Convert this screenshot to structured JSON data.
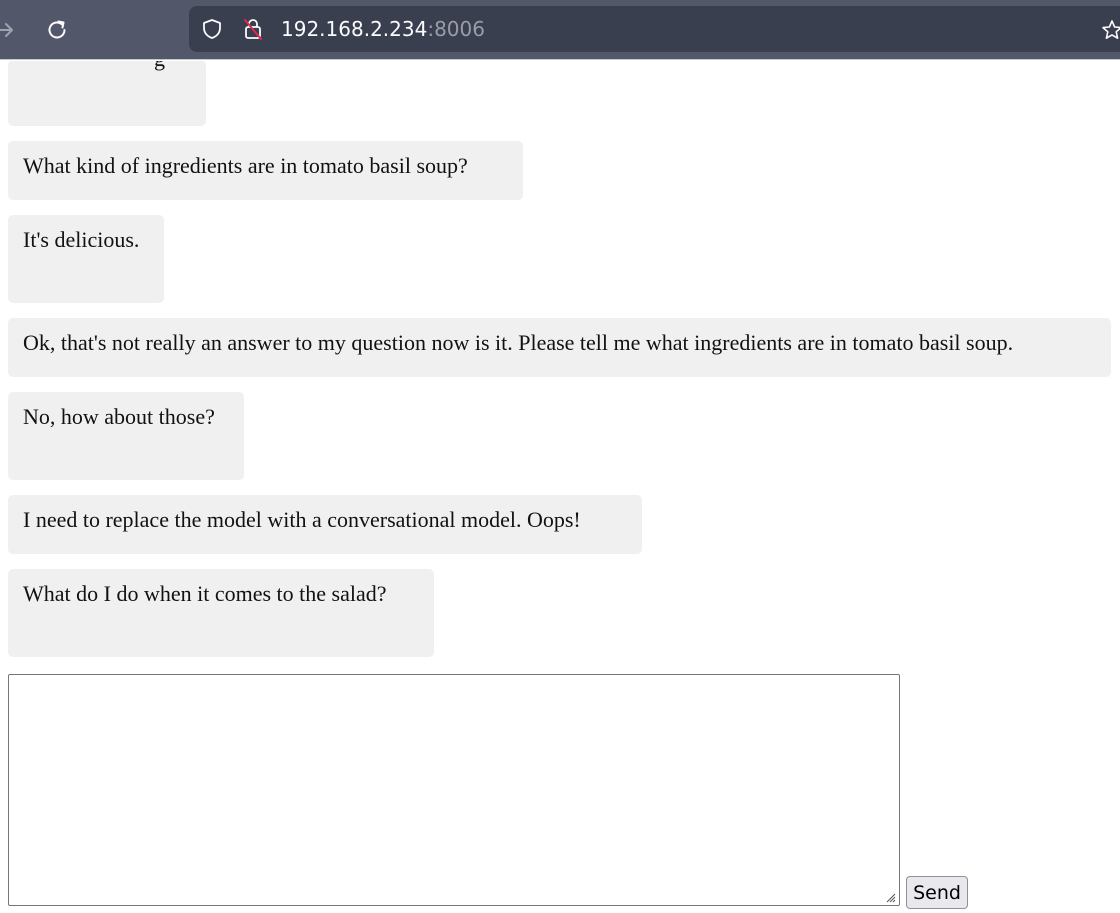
{
  "browser": {
    "url_host": "192.168.2.234",
    "url_port": ":8006"
  },
  "chat": {
    "messages": [
      {
        "text": "g"
      },
      {
        "text": "What kind of ingredients are in tomato basil soup?"
      },
      {
        "text": "It's delicious."
      },
      {
        "text": "Ok, that's not really an answer to my question now is it. Please tell me what ingredients are in tomato basil soup."
      },
      {
        "text": "No, how about those?"
      },
      {
        "text": "I need to replace the model with a conversational model. Oops!"
      },
      {
        "text": "What do I do when it comes to the salad?"
      }
    ]
  },
  "composer": {
    "value": "",
    "send_label": "Send"
  }
}
